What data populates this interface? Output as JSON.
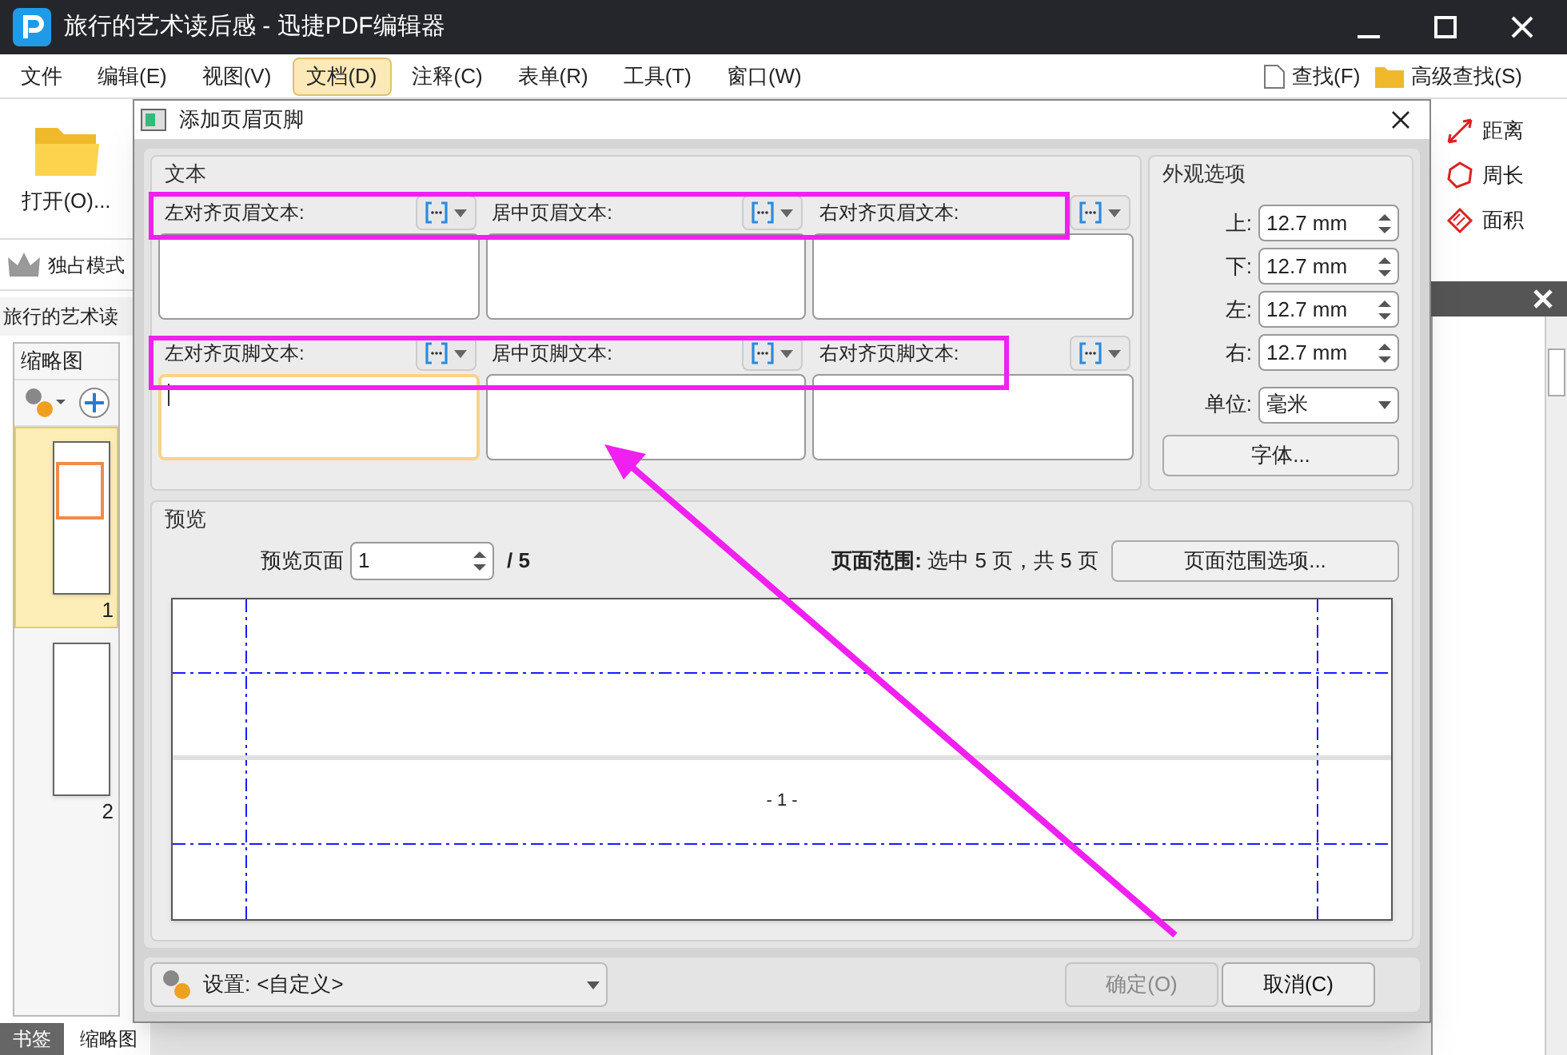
{
  "app": {
    "title": "旅行的艺术读后感 - 迅捷PDF编辑器",
    "menu": [
      {
        "label": "文件",
        "selected": false
      },
      {
        "label": "编辑(E)",
        "selected": false
      },
      {
        "label": "视图(V)",
        "selected": false
      },
      {
        "label": "文档(D)",
        "selected": true
      },
      {
        "label": "注释(C)",
        "selected": false
      },
      {
        "label": "表单(R)",
        "selected": false
      },
      {
        "label": "工具(T)",
        "selected": false
      },
      {
        "label": "窗口(W)",
        "selected": false
      }
    ],
    "search_buttons": [
      "查找(F)",
      "高级查找(S)"
    ],
    "open_button": "打开(O)...",
    "mode_button": "独占模式",
    "doc_tab": "旅行的艺术读",
    "measure_tools": [
      "距离",
      "周长",
      "面积"
    ],
    "thumbnail_panel": {
      "title": "缩略图",
      "pages": [
        {
          "label": "1",
          "selected": true
        },
        {
          "label": "2",
          "selected": false
        }
      ]
    },
    "bottom_tabs": [
      {
        "label": "书签",
        "selected": false
      },
      {
        "label": "缩略图",
        "selected": true
      }
    ]
  },
  "dialog": {
    "title": "添加页眉页脚",
    "text_group": {
      "title": "文本",
      "fields": [
        {
          "label": "左对齐页眉文本:",
          "focused": false
        },
        {
          "label": "居中页眉文本:",
          "focused": false
        },
        {
          "label": "右对齐页眉文本:",
          "focused": false
        },
        {
          "label": "左对齐页脚文本:",
          "focused": true
        },
        {
          "label": "居中页脚文本:",
          "focused": false
        },
        {
          "label": "右对齐页脚文本:",
          "focused": false
        }
      ]
    },
    "appearance": {
      "title": "外观选项",
      "margins": [
        {
          "label": "上:",
          "value": "12.7 mm"
        },
        {
          "label": "下:",
          "value": "12.7 mm"
        },
        {
          "label": "左:",
          "value": "12.7 mm"
        },
        {
          "label": "右:",
          "value": "12.7 mm"
        }
      ],
      "unit": {
        "label": "单位:",
        "value": "毫米"
      },
      "font_button": "字体..."
    },
    "preview": {
      "title": "预览",
      "page_label": "预览页面",
      "page_value": "1",
      "page_total": "/ 5",
      "range": "**页面范围:** 选中 5 页，共 5 页",
      "range_button": "页面范围选项...",
      "page_number": "- 1 -"
    },
    "settings": {
      "label": "设置:",
      "value": "<自定义>"
    },
    "buttons": [
      {
        "label": "确定(O)",
        "disabled": true
      },
      {
        "label": "取消(C)",
        "disabled": false
      }
    ]
  }
}
